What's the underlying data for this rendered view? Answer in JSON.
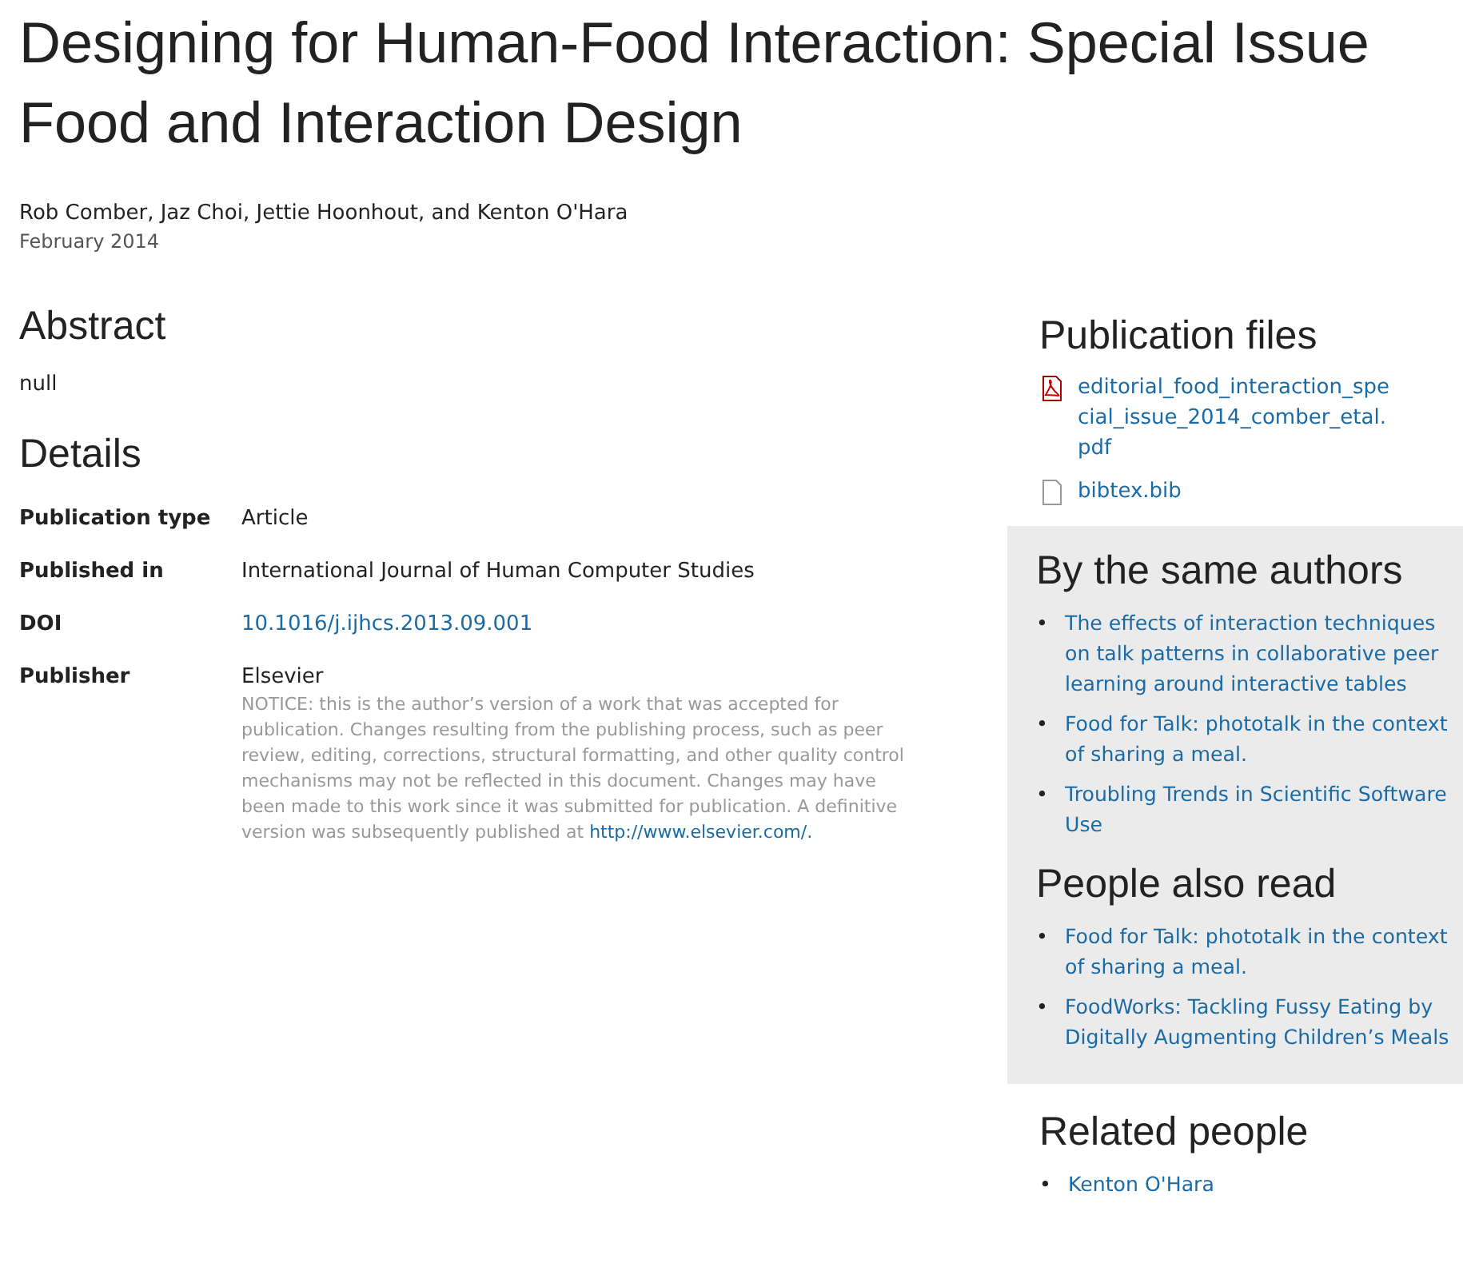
{
  "title_lines": [
    "Designing for Human-Food Interaction: Special Issue",
    "Food and Interaction Design"
  ],
  "authors": "Rob Comber, Jaz Choi, Jettie Hoonhout, and Kenton O'Hara",
  "date": "February 2014",
  "abstract": {
    "heading": "Abstract",
    "text": "null"
  },
  "details": {
    "heading": "Details",
    "rows": [
      {
        "label": "Publication type",
        "value": "Article",
        "kind": "text"
      },
      {
        "label": "Published in",
        "value": "International Journal of Human Computer Studies",
        "kind": "text"
      },
      {
        "label": "DOI",
        "value": "10.1016/j.ijhcs.2013.09.001",
        "kind": "link"
      },
      {
        "label": "Publisher",
        "value": "Elsevier",
        "kind": "text",
        "notice": {
          "text": "NOTICE: this is the author’s version of a work that was accepted for publication. Changes resulting from the publishing process, such as peer review, editing, corrections, structural formatting, and other quality control mechanisms may not be reflected in this document. Changes may have been made to this work since it was submitted for publication. A definitive version was subsequently published at",
          "link": "http://www.elsevier.com/."
        }
      }
    ]
  },
  "publication_files": {
    "heading": "Publication files",
    "files": [
      {
        "name": "editorial_food_interaction_special_issue_2014_comber_etal.pdf",
        "kind": "pdf"
      },
      {
        "name": "bibtex.bib",
        "kind": "text"
      }
    ]
  },
  "same_authors": {
    "heading": "By the same authors",
    "items": [
      {
        "bullet": "•",
        "text": "The effects of interaction techniques on talk patterns in collaborative peer learning around interactive tables"
      },
      {
        "bullet": "•",
        "text": "Food for Talk: phototalk in the context of sharing a meal."
      },
      {
        "bullet": "•",
        "text": "Troubling Trends in Scientific Software Use"
      }
    ]
  },
  "also_read": {
    "heading": "People also read",
    "items": [
      {
        "bullet": "•",
        "text": "Food for Talk: phototalk in the context of sharing a meal."
      },
      {
        "bullet": "•",
        "text": "FoodWorks: Tackling Fussy Eating by Digitally Augmenting Children’s Meals"
      }
    ]
  },
  "related_people": {
    "heading": "Related people",
    "items": [
      {
        "bullet": "•",
        "text": "Kenton O'Hara"
      }
    ]
  }
}
